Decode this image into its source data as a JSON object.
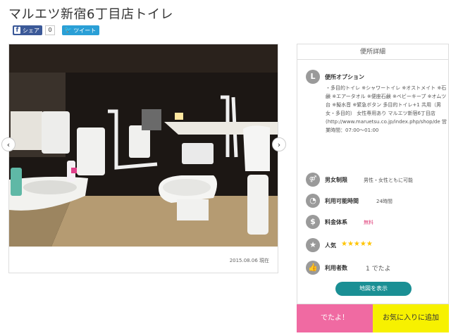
{
  "page": {
    "title": "マルエツ新宿6丁目店トイレ"
  },
  "share": {
    "fb_label": "シェア",
    "fb_count": "0",
    "tw_label": "ツイート"
  },
  "gallery": {
    "caption": "2015.08.06 現在",
    "prev_glyph": "‹",
    "next_glyph": "›"
  },
  "panel": {
    "header": "便所詳細",
    "option": {
      "label": "便所オプション",
      "icon": "L",
      "text": "・多目的トイレ ※シャワートイレ ※オストメイト ※石鹸 ※エアータオル ※便座石鹸 ※ベビーキープ ※オムツ台 ※擬水音 ※緊急ボタン 多目的トイレ+1 共用（男女・多目的） 女性専用あり マルエツ新宿6丁目店 (http://www.maruetsu.co.jp/index.php/shop/de 営業時間：07:00～01:00"
    },
    "gender": {
      "label": "男女制限",
      "value": "男性・女性ともに可能",
      "icon": "restroom-icon"
    },
    "hours": {
      "label": "利用可能時間",
      "value": "24時間",
      "icon": "clock-icon"
    },
    "fee": {
      "label": "料金体系",
      "value": "無料",
      "icon": "$"
    },
    "popularity": {
      "label": "人気",
      "stars": "★★★★★",
      "icon": "★"
    },
    "users": {
      "label": "利用者数",
      "value": "1 でたよ",
      "icon": "thumb-icon"
    },
    "map_button": "地図を表示"
  },
  "actions": {
    "deta": "でたよ！",
    "favorite": "お気に入りに追加"
  },
  "colors": {
    "map_button": "#1a8f94",
    "deta_button": "#f06aa2",
    "favorite_button": "#f7f100",
    "facebook": "#3b5998",
    "twitter": "#2a9fd6",
    "free_text": "#e0407a",
    "stars": "#ffc400"
  }
}
